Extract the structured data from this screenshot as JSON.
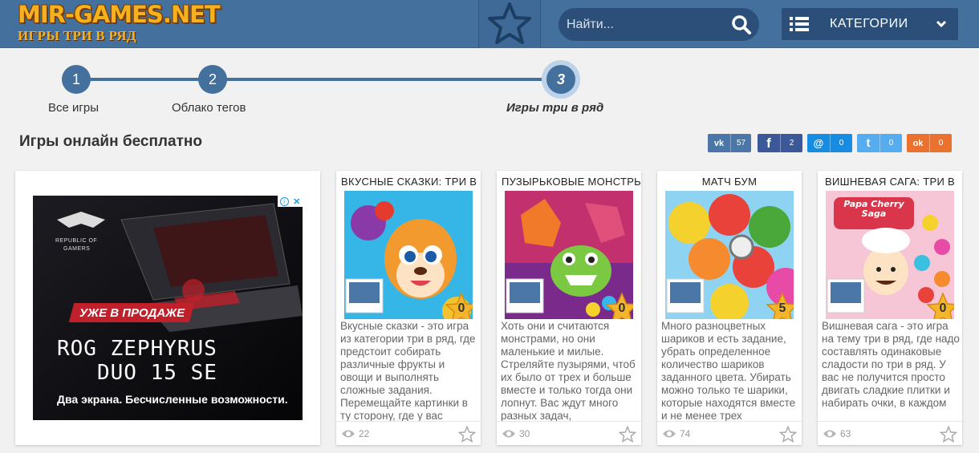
{
  "header": {
    "logo_main": "MIR-GAMES.NET",
    "logo_sub": "ИГРЫ ТРИ В РЯД",
    "search_placeholder": "Найти...",
    "categories_label": "КАТЕГОРИИ",
    "accent_color": "#44709e",
    "logo_color": "#f6b21d"
  },
  "breadcrumb": [
    {
      "number": "1",
      "label": "Все игры"
    },
    {
      "number": "2",
      "label": "Облако тегов"
    },
    {
      "number": "3",
      "label": "Игры три в ряд",
      "active": true
    }
  ],
  "page_title": "Игры онлайн бесплатно",
  "social": [
    {
      "network": "vk",
      "icon": "vk-icon",
      "glyph": "vk",
      "count": "57",
      "color": "#4a76a8"
    },
    {
      "network": "facebook",
      "icon": "facebook-icon",
      "glyph": "f",
      "count": "2",
      "color": "#3b5998"
    },
    {
      "network": "moimir",
      "icon": "moimir-icon",
      "glyph": "@",
      "count": "0",
      "color": "#168de2"
    },
    {
      "network": "twitter",
      "icon": "twitter-icon",
      "glyph": "t",
      "count": "0",
      "color": "#55acee"
    },
    {
      "network": "odnoklassniki",
      "icon": "odnoklassniki-icon",
      "glyph": "ok",
      "count": "0",
      "color": "#eb722e"
    }
  ],
  "ad": {
    "badge": "УЖЕ В ПРОДАЖЕ",
    "brand_line1": "REPUBLIC OF",
    "brand_line2": "GAMERS",
    "product_line1": "ROG ZEPHYRUS",
    "product_line2": "DUO 15 SE",
    "tagline": "Два экрана. Бесчисленные возможности."
  },
  "games": [
    {
      "title": "ВКУСНЫЕ СКАЗКИ: ТРИ В",
      "rating": "0",
      "description": "Вкусные сказки - это игра из категории три в ряд, где предстоит собирать различные фрукты и овощи и выполнять сложные задания. Перемещайте картинки в ту сторону, где у вас",
      "views": "22",
      "thumb_colors": [
        "#36b6e6",
        "#f29a2e"
      ]
    },
    {
      "title": "ПУЗЫРЬКОВЫЕ МОНСТРЫ",
      "rating": "0",
      "description": "Хоть они и считаются монстрами, но они маленькие и милые. Стреляйте пузырями, чтоб их было от трех и больше вместе и только тогда они лопнут. Вас ждут много разных задач,",
      "views": "30",
      "thumb_colors": [
        "#c2306e",
        "#7bc943"
      ]
    },
    {
      "title": "МАТЧ БУМ",
      "rating": "5",
      "description": "Много разноцветных шариков и есть задание, убрать определенное количество шариков заданного цвета. Убирать можно только те шарики, которые находятся вместе и не менее трех",
      "views": "74",
      "thumb_colors": [
        "#8fd3f2",
        "#e8423a"
      ]
    },
    {
      "title": "ВИШНЕВАЯ САГА: ТРИ В",
      "rating": "0",
      "logo_text": "Papa Cherry Saga",
      "description": "Вишневая сага - это игра на тему три в ряд, где надо составлять одинаковые сладости по три в ряд. У вас не получится просто двигать сладкие плитки и набирать очки, в каждом",
      "views": "63",
      "thumb_colors": [
        "#f7c6d6",
        "#d9364c"
      ]
    }
  ]
}
